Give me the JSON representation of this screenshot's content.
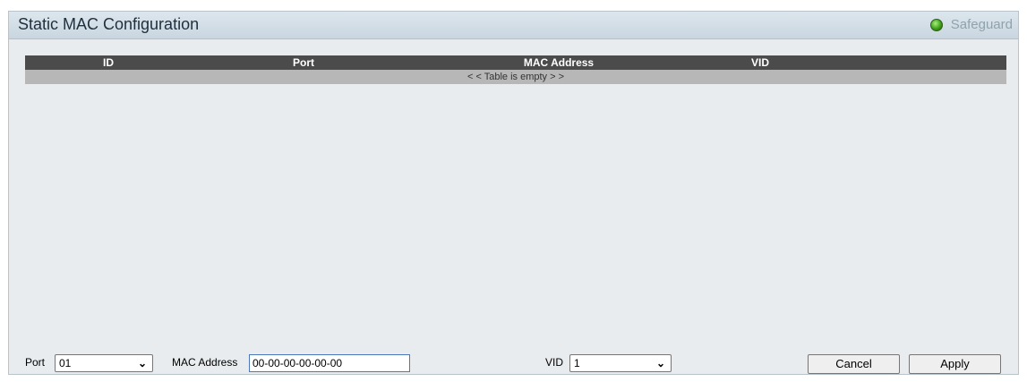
{
  "panel": {
    "title": "Static MAC Configuration",
    "safeguard_label": "Safeguard"
  },
  "table": {
    "columns": [
      "ID",
      "Port",
      "MAC Address",
      "VID"
    ],
    "empty_message": "< < Table is empty > >"
  },
  "form": {
    "port_label": "Port",
    "port_value": "01",
    "mac_label": "MAC Address",
    "mac_value": "00-00-00-00-00-00",
    "vid_label": "VID",
    "vid_value": "1",
    "cancel_label": "Cancel",
    "apply_label": "Apply"
  },
  "colors": {
    "header_bg": "#4b4b4b",
    "empty_row_bg": "#b7b7b7",
    "panel_bg": "#e8ecee",
    "safeguard_text": "#8fa3ad",
    "safeguard_indicator": "#3fa01a"
  },
  "icons": {
    "safeguard": "status-indicator-icon",
    "dropdown": "chevron-down-icon"
  }
}
